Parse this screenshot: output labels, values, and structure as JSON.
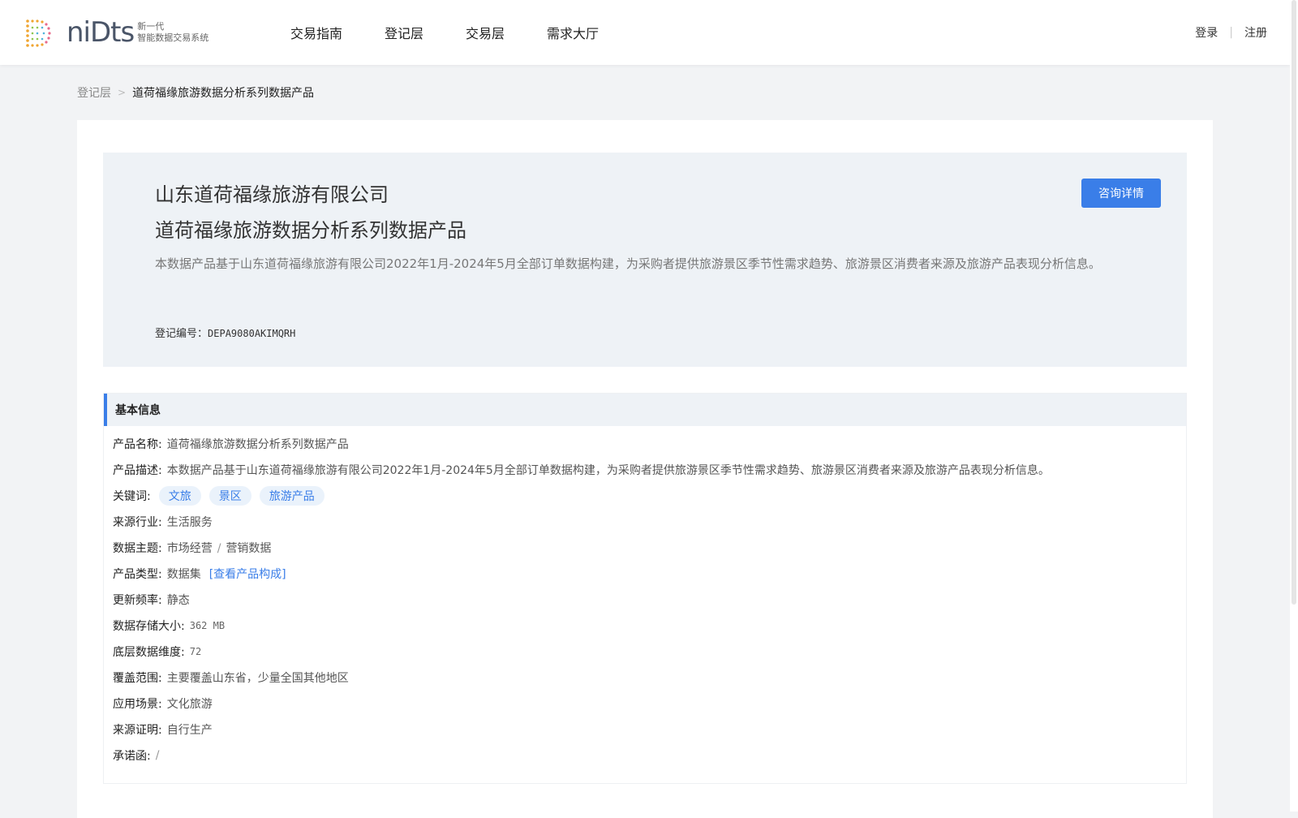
{
  "header": {
    "logo_word": "niDts",
    "logo_sub_line1": "新一代",
    "logo_sub_line2": "智能数据交易系统",
    "nav": [
      "交易指南",
      "登记层",
      "交易层",
      "需求大厅"
    ],
    "login": "登录",
    "auth_sep": "|",
    "register": "注册"
  },
  "breadcrumb": {
    "parent": "登记层",
    "separator": ">",
    "current": "道荷福缘旅游数据分析系列数据产品"
  },
  "hero": {
    "company": "山东道荷福缘旅游有限公司",
    "product": "道荷福缘旅游数据分析系列数据产品",
    "description": "本数据产品基于山东道荷福缘旅游有限公司2022年1月-2024年5月全部订单数据构建，为采购者提供旅游景区季节性需求趋势、旅游景区消费者来源及旅游产品表现分析信息。",
    "reg_label": "登记编号：",
    "reg_code": "DEPA9080AKIMQRH",
    "consult_button": "咨询详情"
  },
  "basic_info": {
    "title": "基本信息",
    "product_name_label": "产品名称:",
    "product_name": "道荷福缘旅游数据分析系列数据产品",
    "product_desc_label": "产品描述:",
    "product_desc": "本数据产品基于山东道荷福缘旅游有限公司2022年1月-2024年5月全部订单数据构建，为采购者提供旅游景区季节性需求趋势、旅游景区消费者来源及旅游产品表现分析信息。",
    "keywords_label": "关键词:",
    "keywords": [
      "文旅",
      "景区",
      "旅游产品"
    ],
    "industry_label": "来源行业:",
    "industry": "生活服务",
    "theme_label": "数据主题:",
    "theme_main": "市场经营",
    "theme_sep": "/",
    "theme_sub": "营销数据",
    "type_label": "产品类型:",
    "type": "数据集",
    "type_link": "[查看产品构成]",
    "freq_label": "更新频率:",
    "freq": "静态",
    "size_label": "数据存储大小:",
    "size": "362 MB",
    "dims_label": "底层数据维度:",
    "dims": "72",
    "coverage_label": "覆盖范围:",
    "coverage": "主要覆盖山东省，少量全国其他地区",
    "scenario_label": "应用场景:",
    "scenario": "文化旅游",
    "proof_label": "来源证明:",
    "proof": "自行生产",
    "promise_label": "承诺函:",
    "promise": "/"
  },
  "colors": {
    "accent": "#3a7ee8",
    "background": "#f2f3f5",
    "hero_bg": "#eef2f6"
  }
}
